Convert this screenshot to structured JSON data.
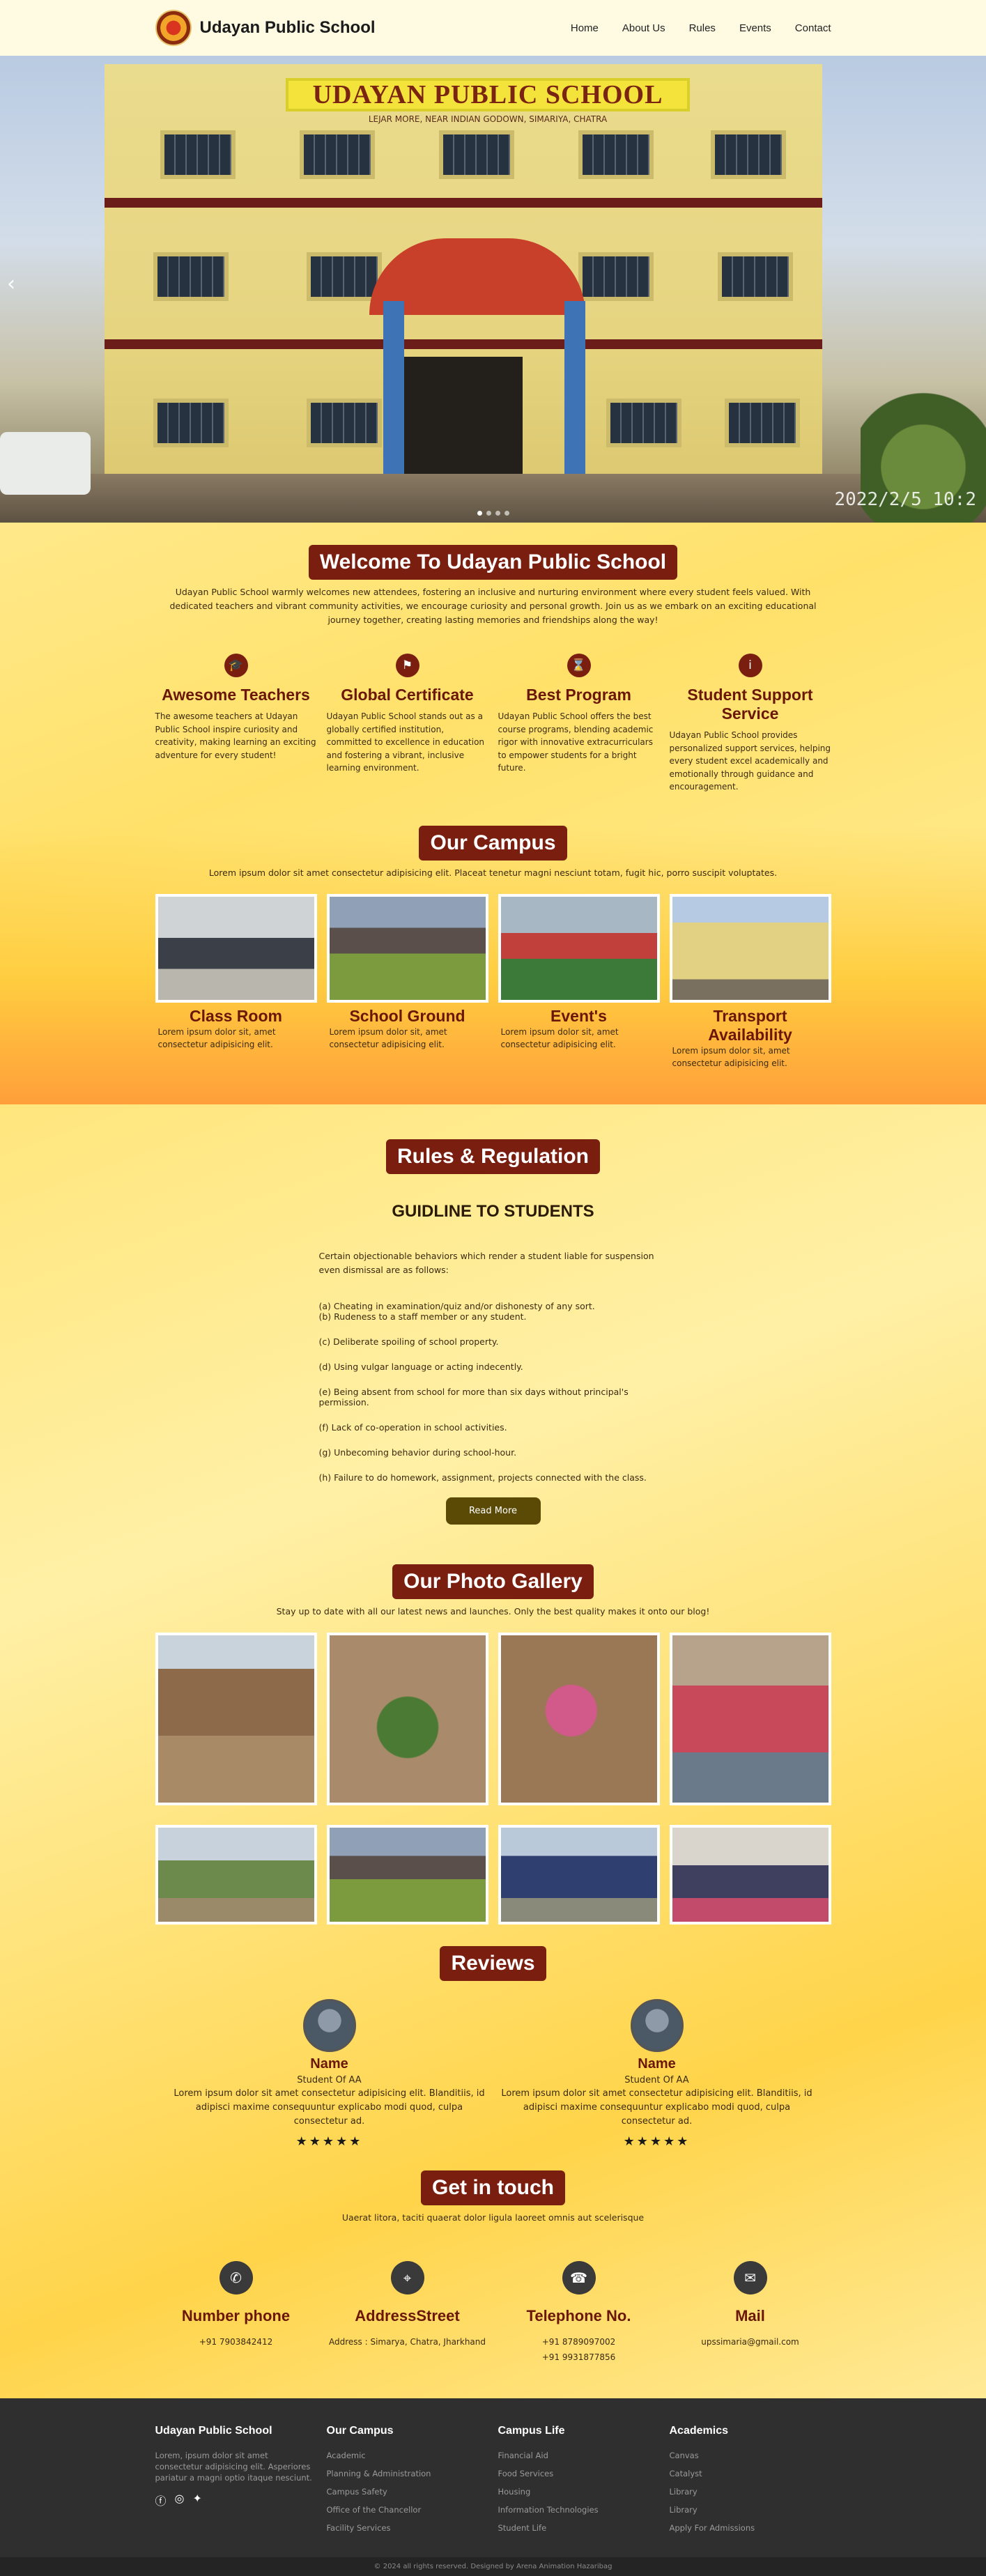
{
  "header": {
    "brand": "Udayan Public School",
    "nav": [
      "Home",
      "About Us",
      "Rules",
      "Events",
      "Contact"
    ]
  },
  "hero": {
    "sign": "UDAYAN PUBLIC SCHOOL",
    "sign_sub": "LEJAR MORE, NEAR INDIAN GODOWN, SIMARIYA, CHATRA",
    "stamp": "2022/2/5 10:2"
  },
  "welcome": {
    "title": "Welcome To Udayan Public School",
    "text": "Udayan Public School warmly welcomes new attendees, fostering an inclusive and nurturing environment where every student feels valued. With dedicated teachers and vibrant community activities, we encourage curiosity and personal growth. Join us as we embark on an exciting educational journey together, creating lasting memories and friendships along the way!",
    "features": [
      {
        "title": "Awesome Teachers",
        "text": "The awesome teachers at Udayan Public School inspire curiosity and creativity, making learning an exciting adventure for every student!"
      },
      {
        "title": "Global Certificate",
        "text": "Udayan Public School stands out as a globally certified institution, committed to excellence in education and fostering a vibrant, inclusive learning environment."
      },
      {
        "title": "Best Program",
        "text": "Udayan Public School offers the best course programs, blending academic rigor with innovative extracurriculars to empower students for a bright future."
      },
      {
        "title": "Student Support Service",
        "text": "Udayan Public School provides personalized support services, helping every student excel academically and emotionally through guidance and encouragement."
      }
    ]
  },
  "campus": {
    "title": "Our Campus",
    "text": "Lorem ipsum dolor sit amet consectetur adipisicing elit. Placeat tenetur magni nesciunt totam, fugit hic, porro suscipit voluptates.",
    "cards": [
      {
        "title": "Class Room",
        "text": "Lorem ipsum dolor sit, amet consectetur adipisicing elit."
      },
      {
        "title": "School Ground",
        "text": "Lorem ipsum dolor sit, amet consectetur adipisicing elit."
      },
      {
        "title": "Event's",
        "text": "Lorem ipsum dolor sit, amet consectetur adipisicing elit."
      },
      {
        "title": "Transport Availability",
        "text": "Lorem ipsum dolor sit, amet consectetur adipisicing elit."
      }
    ]
  },
  "rules": {
    "title": "Rules & Regulation",
    "heading": "GUIDLINE TO STUDENTS",
    "lead": "Certain objectionable behaviors which render a student liable for suspension even dismissal are as follows:",
    "items": [
      "(a) Cheating in examination/quiz and/or dishonesty of any sort.",
      "(b) Rudeness to a staff member or any student.",
      "(c) Deliberate spoiling of school property.",
      "(d) Using vulgar language or acting indecently.",
      "(e) Being absent from school for more than six days without principal's permission.",
      "(f) Lack of co-operation in school activities.",
      "(g) Unbecoming behavior during school-hour.",
      "(h) Failure to do homework, assignment, projects connected with the class."
    ],
    "button": "Read More"
  },
  "gallery": {
    "title": "Our Photo Gallery",
    "text": "Stay up to date with all our latest news and launches. Only the best quality makes it onto our blog!"
  },
  "reviews": {
    "title": "Reviews",
    "items": [
      {
        "name": "Name",
        "role": "Student Of AA",
        "text": "Lorem ipsum dolor sit amet consectetur adipisicing elit. Blanditiis, id adipisci maxime consequuntur explicabo modi quod, culpa consectetur ad.",
        "stars": "★★★★★"
      },
      {
        "name": "Name",
        "role": "Student Of AA",
        "text": "Lorem ipsum dolor sit amet consectetur adipisicing elit. Blanditiis, id adipisci maxime consequuntur explicabo modi quod, culpa consectetur ad.",
        "stars": "★★★★★"
      }
    ]
  },
  "contact": {
    "title": "Get in touch",
    "text": "Uaerat litora, taciti quaerat dolor ligula laoreet omnis aut scelerisque",
    "items": [
      {
        "title": "Number phone",
        "lines": [
          "+91 7903842412",
          ""
        ]
      },
      {
        "title": "AddressStreet",
        "lines": [
          "Address : Simarya, Chatra, Jharkhand",
          ""
        ]
      },
      {
        "title": "Telephone No.",
        "lines": [
          "+91 8789097002",
          "+91 9931877856"
        ]
      },
      {
        "title": "Mail",
        "lines": [
          "upssimaria@gmail.com",
          ""
        ]
      }
    ]
  },
  "footer": {
    "about_title": "Udayan Public School",
    "about_text": "Lorem, ipsum dolor sit amet consectetur adipisicing elit. Asperiores pariatur a magni optio itaque nesciunt.",
    "cols": [
      {
        "title": "Our Campus",
        "links": [
          "Academic",
          "Planning & Administration",
          "Campus Safety",
          "Office of the Chancellor",
          "Facility Services"
        ]
      },
      {
        "title": "Campus Life",
        "links": [
          "Financial Aid",
          "Food Services",
          "Housing",
          "Information Technologies",
          "Student Life"
        ]
      },
      {
        "title": "Academics",
        "links": [
          "Canvas",
          "Catalyst",
          "Library",
          "Library",
          "Apply For Admissions"
        ]
      }
    ],
    "copyright": "© 2024 all rights reserved. Designed by Arena Animation Hazaribag"
  }
}
